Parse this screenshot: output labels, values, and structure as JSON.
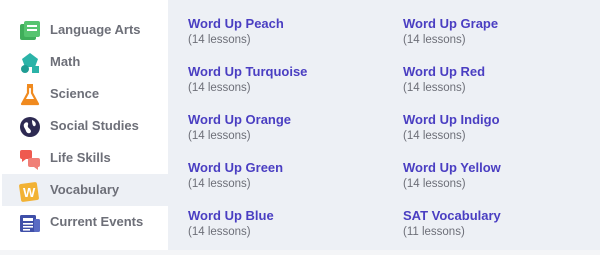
{
  "colors": {
    "link": "#4a3ec2",
    "muted_text": "#6d6f78",
    "panel_background": "#edf0f5",
    "active_item_background": "#edf0f5"
  },
  "sidebar": {
    "items": [
      {
        "label": "Language Arts",
        "icon": "book-icon",
        "active": false
      },
      {
        "label": "Math",
        "icon": "shapes-icon",
        "active": false
      },
      {
        "label": "Science",
        "icon": "flask-icon",
        "active": false
      },
      {
        "label": "Social Studies",
        "icon": "globe-icon",
        "active": false
      },
      {
        "label": "Life Skills",
        "icon": "chat-bubbles-icon",
        "active": false
      },
      {
        "label": "Vocabulary",
        "icon": "w-tile-icon",
        "active": true
      },
      {
        "label": "Current Events",
        "icon": "newspaper-icon",
        "active": false
      }
    ]
  },
  "lessons": {
    "left": [
      {
        "title": "Word Up Peach",
        "count": "(14 lessons)"
      },
      {
        "title": "Word Up Turquoise",
        "count": "(14 lessons)"
      },
      {
        "title": "Word Up Orange",
        "count": "(14 lessons)"
      },
      {
        "title": "Word Up Green",
        "count": "(14 lessons)"
      },
      {
        "title": "Word Up Blue",
        "count": "(14 lessons)"
      }
    ],
    "right": [
      {
        "title": "Word Up Grape",
        "count": "(14 lessons)"
      },
      {
        "title": "Word Up Red",
        "count": "(14 lessons)"
      },
      {
        "title": "Word Up Indigo",
        "count": "(14 lessons)"
      },
      {
        "title": "Word Up Yellow",
        "count": "(14 lessons)"
      },
      {
        "title": "SAT Vocabulary",
        "count": "(11 lessons)"
      }
    ]
  }
}
